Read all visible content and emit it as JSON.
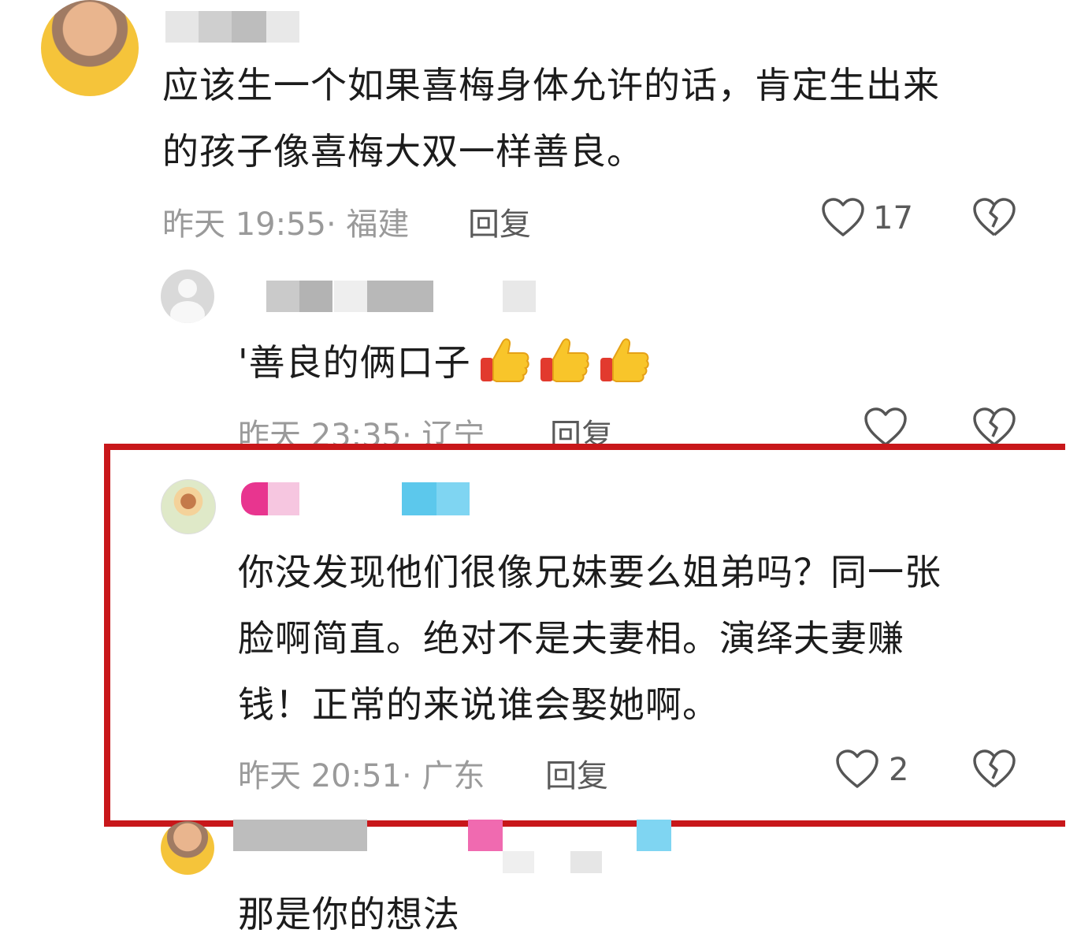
{
  "comments": [
    {
      "text_lines": [
        "应该生一个如果喜梅身体允许的话，肯定生出来",
        "的孩子像喜梅大双一样善良。"
      ],
      "meta": "昨天 19:55· 福建",
      "reply": "回复",
      "likes": "17"
    },
    {
      "text": "'善良的俩口子",
      "emoji": [
        "thumbs-up",
        "thumbs-up",
        "thumbs-up"
      ],
      "meta": "昨天 23:35· 辽宁",
      "reply": "回复",
      "likes": ""
    },
    {
      "text_lines": [
        "你没发现他们很像兄妹要么姐弟吗？同一张",
        "脸啊简直。绝对不是夫妻相。演绎夫妻赚",
        "钱！正常的来说谁会娶她啊。"
      ],
      "meta": "昨天 20:51· 广东",
      "reply": "回复",
      "likes": "2"
    },
    {
      "text": "那是你的想法"
    }
  ],
  "colors": {
    "highlight_border": "#c8171a",
    "meta_text": "#9a9a9a"
  },
  "icons": [
    "heart-outline-icon",
    "broken-heart-icon"
  ]
}
